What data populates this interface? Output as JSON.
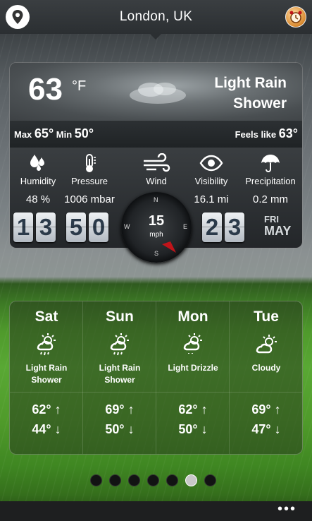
{
  "header": {
    "city": "London, UK"
  },
  "current": {
    "temperature": "63",
    "unit": "°F",
    "condition_line1": "Light Rain",
    "condition_line2": "Shower",
    "max_label": "Max",
    "max_value": "65°",
    "min_label": "Min",
    "min_value": "50°",
    "feels_label": "Feels like",
    "feels_value": "63°"
  },
  "metrics": [
    {
      "label": "Humidity",
      "value": "48 %",
      "icon": "humidity-icon"
    },
    {
      "label": "Pressure",
      "value": "1006 mbar",
      "icon": "thermometer-icon"
    },
    {
      "label": "Wind",
      "value": "",
      "icon": "wind-icon"
    },
    {
      "label": "Visibility",
      "value": "16.1 mi",
      "icon": "eye-icon"
    },
    {
      "label": "Precipitation",
      "value": "0.2 mm",
      "icon": "umbrella-icon"
    }
  ],
  "time_digits": [
    "1",
    "3",
    "5",
    "0"
  ],
  "date_digits": [
    "2",
    "3"
  ],
  "day_short": "FRI",
  "month_short": "MAY",
  "wind": {
    "speed": "15",
    "unit": "mph",
    "n": "N",
    "e": "E",
    "s": "S",
    "w": "W"
  },
  "forecast": [
    {
      "day": "Sat",
      "condition_line1": "Light Rain",
      "condition_line2": "Shower",
      "high": "62° ↑",
      "low": "44° ↓",
      "icon": "rain-shower-icon"
    },
    {
      "day": "Sun",
      "condition_line1": "Light Rain",
      "condition_line2": "Shower",
      "high": "69° ↑",
      "low": "50° ↓",
      "icon": "rain-shower-icon"
    },
    {
      "day": "Mon",
      "condition_line1": "Light Drizzle",
      "condition_line2": "",
      "high": "62° ↑",
      "low": "50° ↓",
      "icon": "drizzle-icon"
    },
    {
      "day": "Tue",
      "condition_line1": "Cloudy",
      "condition_line2": "",
      "high": "69° ↑",
      "low": "47° ↓",
      "icon": "partly-cloudy-icon"
    }
  ],
  "pager": {
    "count": 7,
    "active_index": 5
  },
  "app_bar": {
    "more": "•••"
  },
  "colors": {
    "digit_text": "#2b3a4a",
    "wind_needle": "#c0141a",
    "alarm_orange": "#d98a2f"
  }
}
